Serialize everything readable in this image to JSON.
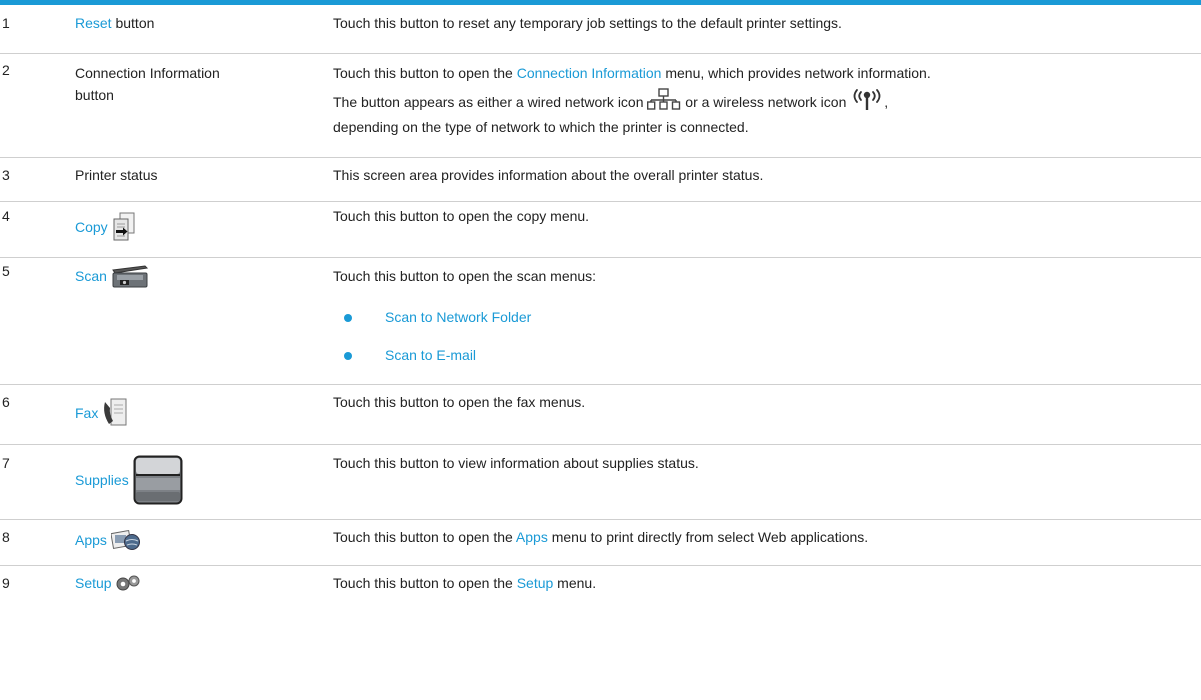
{
  "colors": {
    "accent": "#1a9ad6",
    "rule": "#cfcfcf",
    "text": "#222222"
  },
  "rows": [
    {
      "num": "1",
      "item_link": "Reset",
      "item_rest": " button",
      "desc": "Touch this button to reset any temporary job settings to the default printer settings."
    },
    {
      "num": "2",
      "item_line1": "Connection Information",
      "item_line2": "button",
      "desc_a": "Touch this button to open the ",
      "desc_link": "Connection Information",
      "desc_b": " menu, which provides network information.",
      "desc_c": "The button appears as either a wired network icon",
      "desc_d": "or a wireless network icon",
      "desc_e": ",",
      "desc_f": "depending on the type of network to which the printer is connected.",
      "icons": [
        "wired-network-icon",
        "wireless-network-icon"
      ]
    },
    {
      "num": "3",
      "item": "Printer status",
      "desc": "This screen area provides information about the overall printer status."
    },
    {
      "num": "4",
      "item_link": "Copy",
      "icon": "copy-icon",
      "desc": "Touch this button to open the copy menu."
    },
    {
      "num": "5",
      "item_link": "Scan",
      "icon": "scan-icon",
      "desc": "Touch this button to open the scan menus:",
      "bullets": [
        "Scan to Network Folder",
        "Scan to E-mail"
      ]
    },
    {
      "num": "6",
      "item_link": "Fax",
      "icon": "fax-icon",
      "desc": "Touch this button to open the fax menus."
    },
    {
      "num": "7",
      "item_link": "Supplies",
      "icon": "supplies-icon",
      "desc": "Touch this button to view information about supplies status."
    },
    {
      "num": "8",
      "item_link": "Apps",
      "icon": "apps-icon",
      "desc_a": "Touch this button to open the ",
      "desc_link": "Apps",
      "desc_b": " menu to print directly from select Web applications."
    },
    {
      "num": "9",
      "item_link": "Setup",
      "icon": "setup-icon",
      "desc_a": "Touch this button to open the ",
      "desc_link": "Setup",
      "desc_b": " menu."
    }
  ]
}
